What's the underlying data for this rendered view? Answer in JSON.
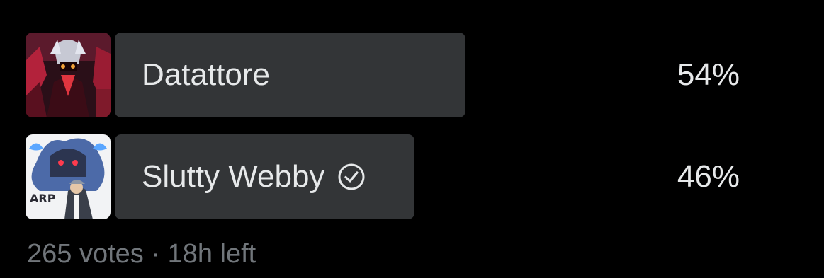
{
  "poll": {
    "options": [
      {
        "label": "Datattore",
        "percent": "54%",
        "fraction": 0.54,
        "selected": false,
        "thumbnail_icon": "avatar-image"
      },
      {
        "label": "Slutty Webby",
        "percent": "46%",
        "fraction": 0.46,
        "selected": true,
        "thumbnail_icon": "avatar-image",
        "selected_icon": "check-circle-icon",
        "thumbnail_text": "ARP"
      }
    ],
    "votes": "265 votes",
    "separator": "·",
    "time_left": "18h left"
  },
  "colors": {
    "background": "#000000",
    "bar": "#333537",
    "text": "#e7e9ea",
    "muted": "#71767b"
  }
}
